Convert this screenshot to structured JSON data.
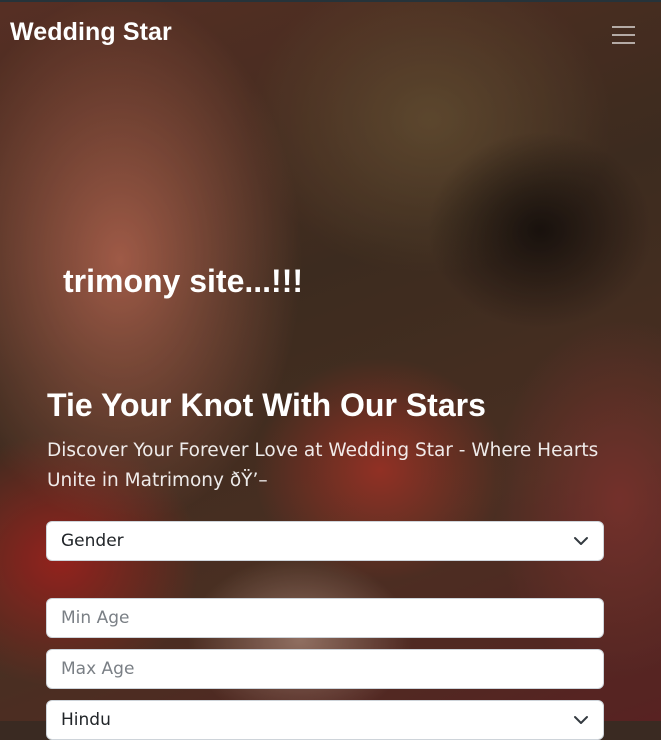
{
  "navbar": {
    "brand": "Wedding Star",
    "menu_icon": "hamburger-icon"
  },
  "hero": {
    "typed_text": "trimony site...!!!",
    "headline": "Tie Your Knot With Our Stars",
    "subline": "Discover Your Forever Love at Wedding Star - Where Hearts Unite in Matrimony ðŸ’–"
  },
  "search_form": {
    "gender": {
      "selected": "Gender",
      "icon": "chevron-down-icon"
    },
    "min_age": {
      "placeholder": "Min Age"
    },
    "max_age": {
      "placeholder": "Max Age"
    },
    "religion": {
      "selected": "Hindu",
      "icon": "chevron-down-icon"
    }
  },
  "colors": {
    "text_primary": "#ffffff",
    "field_background": "#ffffff",
    "field_border": "#ced4da"
  }
}
